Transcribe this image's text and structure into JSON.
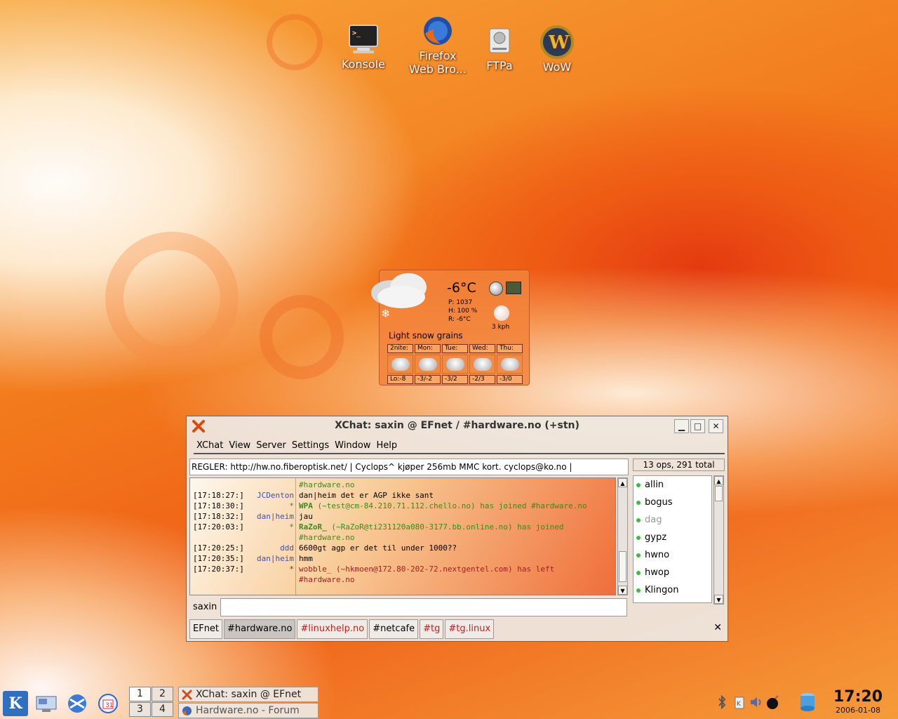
{
  "desktop": {
    "icons": [
      {
        "label": "Konsole",
        "icon": "terminal-icon"
      },
      {
        "label": "Firefox\nWeb Bro...",
        "icon": "firefox-icon"
      },
      {
        "label": "FTPa",
        "icon": "harddisk-icon"
      },
      {
        "label": "WoW",
        "icon": "wow-icon"
      }
    ]
  },
  "weather": {
    "temperature": "-6°C",
    "pressure": "P:  1037",
    "humidity": "H:  100 %",
    "realfeel": "R:  -6°C",
    "wind": "3 kph",
    "condition": "Light snow grains",
    "forecast": [
      {
        "day": "2nite:",
        "value": "Lo:-8"
      },
      {
        "day": "Mon:",
        "value": "-3/-2"
      },
      {
        "day": "Tue:",
        "value": "-3/2"
      },
      {
        "day": "Wed:",
        "value": "-2/3"
      },
      {
        "day": "Thu:",
        "value": "-3/0"
      }
    ]
  },
  "xchat": {
    "title": "XChat: saxin @ EFnet / #hardware.no (+stn)",
    "menu": [
      "XChat",
      "View",
      "Server",
      "Settings",
      "Window",
      "Help"
    ],
    "topic": "REGLER: http://hw.no.fiberoptisk.net/ | Cyclops^ kjøper 256mb MMC kort. cyclops@ko.no |",
    "ops_count": "13 ops, 291 total",
    "lines": [
      {
        "ts": "",
        "nick": "",
        "msg": "#hardware.no",
        "nick_color": "#000000",
        "msg_color": "#3a8a1a"
      },
      {
        "ts": "[17:18:27:]",
        "nick": "JCDenton",
        "msg": "dan|heim det er AGP ikke sant",
        "nick_color": "#3f4fb0",
        "msg_color": "#000000"
      },
      {
        "ts": "[17:18:30:]",
        "nick": "*",
        "msg_bold": "WPA",
        "msg": " (~test@cm-84.210.71.112.chello.no) has joined #hardware.no",
        "nick_color": "#3a8a1a",
        "msg_color": "#3a8a1a"
      },
      {
        "ts": "[17:18:32:]",
        "nick": "dan|heim",
        "msg": "jau",
        "nick_color": "#3f4fb0",
        "msg_color": "#000000"
      },
      {
        "ts": "[17:20:03:]",
        "nick": "*",
        "msg_bold": "RaZoR_",
        "msg": " (~RaZoR@ti231120a080-3177.bb.online.no) has joined",
        "nick_color": "#3a8a1a",
        "msg_color": "#3a8a1a"
      },
      {
        "ts": "",
        "nick": "",
        "msg": "#hardware.no",
        "nick_color": "#000000",
        "msg_color": "#3a8a1a"
      },
      {
        "ts": "[17:20:25:]",
        "nick": "ddd",
        "msg": "6600gt agp er det til under 1000??",
        "nick_color": "#3f4fb0",
        "msg_color": "#000000"
      },
      {
        "ts": "[17:20:35:]",
        "nick": "dan|heim",
        "msg": "hmm",
        "nick_color": "#3f4fb0",
        "msg_color": "#000000"
      },
      {
        "ts": "[17:20:37:]",
        "nick": "*",
        "msg": "wobble_ (~hkmoen@172.80-202-72.nextgentel.com) has left",
        "nick_color": "#b02020",
        "msg_color": "#a02020"
      },
      {
        "ts": "",
        "nick": "",
        "msg": "#hardware.no",
        "nick_color": "#000000",
        "msg_color": "#a02020"
      }
    ],
    "users": [
      {
        "name": "allin",
        "color": "#000000"
      },
      {
        "name": "bogus",
        "color": "#000000"
      },
      {
        "name": "dag",
        "color": "#999999"
      },
      {
        "name": "gypz",
        "color": "#000000"
      },
      {
        "name": "hwno",
        "color": "#000000"
      },
      {
        "name": "hwop",
        "color": "#000000"
      },
      {
        "name": "Klingon",
        "color": "#000000"
      }
    ],
    "nick": "saxin",
    "tabs": [
      {
        "label": "EFnet",
        "state": "normal"
      },
      {
        "label": "#hardware.no",
        "state": "active"
      },
      {
        "label": "#linuxhelp.no",
        "state": "red"
      },
      {
        "label": "#netcafe",
        "state": "normal"
      },
      {
        "label": "#tg",
        "state": "red"
      },
      {
        "label": "#tg.linux",
        "state": "red"
      }
    ]
  },
  "taskbar": {
    "pager": [
      "1",
      "2",
      "3",
      "4"
    ],
    "tasks": [
      {
        "label": "XChat: saxin @ EFnet",
        "icon": "xchat-icon"
      },
      {
        "label": "Hardware.no - Forum",
        "icon": "firefox-icon"
      }
    ],
    "clock_time": "17:20",
    "clock_date": "2006-01-08"
  }
}
